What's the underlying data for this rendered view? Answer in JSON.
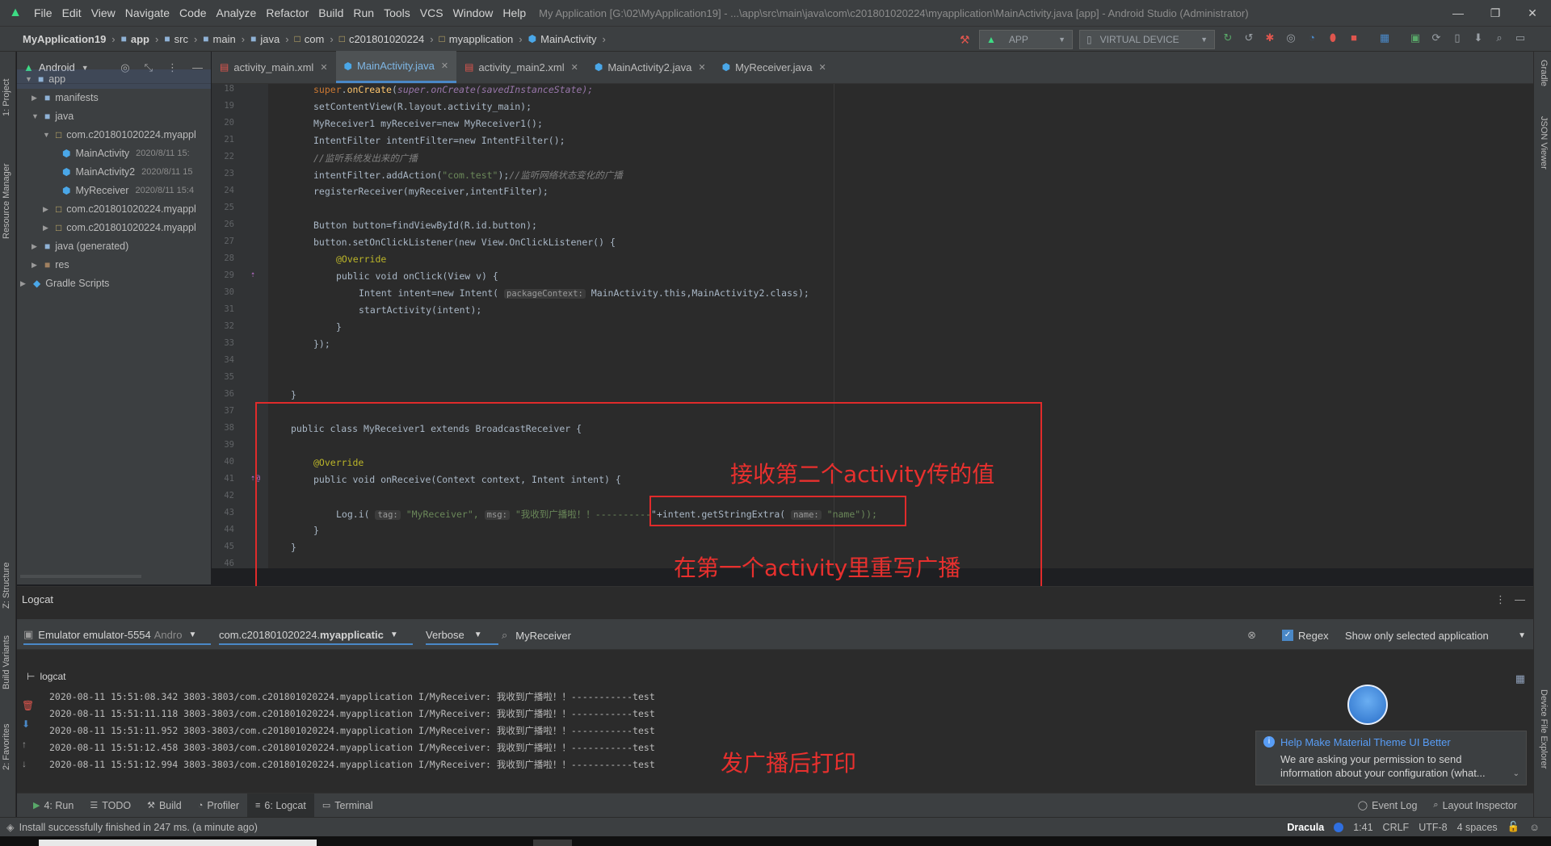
{
  "titlebar": {
    "menu": [
      "File",
      "Edit",
      "View",
      "Navigate",
      "Code",
      "Analyze",
      "Refactor",
      "Build",
      "Run",
      "Tools",
      "VCS",
      "Window",
      "Help"
    ],
    "window_title": "My Application [G:\\02\\MyApplication19] - ...\\app\\src\\main\\java\\com\\c201801020224\\myapplication\\MainActivity.java [app] - Android Studio (Administrator)",
    "minimize": "—",
    "maximize": "❐",
    "close": "✕"
  },
  "breadcrumb": [
    "MyApplication19",
    "app",
    "src",
    "main",
    "java",
    "com",
    "c201801020224",
    "myapplication",
    "MainActivity"
  ],
  "run_config": {
    "module": "APP",
    "device": "VIRTUAL DEVICE"
  },
  "left_strip": {
    "project": "1: Project",
    "resource_manager": "Resource Manager",
    "structure": "Z: Structure",
    "build_variants": "Build Variants",
    "favorites": "2: Favorites"
  },
  "right_strip": {
    "gradle": "Gradle",
    "json_viewer": "JSON Viewer",
    "device_file_explorer": "Device File Explorer"
  },
  "project": {
    "view_mode": "Android",
    "tree": [
      {
        "label": "app",
        "date": ""
      },
      {
        "label": "manifests",
        "date": ""
      },
      {
        "label": "java",
        "date": ""
      },
      {
        "label": "com.c201801020224.myappl",
        "date": ""
      },
      {
        "label": "MainActivity",
        "date": "2020/8/11 15:"
      },
      {
        "label": "MainActivity2",
        "date": "2020/8/11 15"
      },
      {
        "label": "MyReceiver",
        "date": "2020/8/11 15:4"
      },
      {
        "label": "com.c201801020224.myappl",
        "date": ""
      },
      {
        "label": "com.c201801020224.myappl",
        "date": ""
      },
      {
        "label": "java (generated)",
        "date": ""
      },
      {
        "label": "res",
        "date": ""
      },
      {
        "label": "Gradle Scripts",
        "date": ""
      }
    ]
  },
  "tabs": [
    {
      "label": "activity_main.xml",
      "active": false
    },
    {
      "label": "MainActivity.java",
      "active": true
    },
    {
      "label": "activity_main2.xml",
      "active": false
    },
    {
      "label": "MainActivity2.java",
      "active": false
    },
    {
      "label": "MyReceiver.java",
      "active": false
    }
  ],
  "editor": {
    "line_numbers": [
      "18",
      "19",
      "20",
      "21",
      "22",
      "23",
      "24",
      "25",
      "26",
      "27",
      "28",
      "29",
      "30",
      "31",
      "32",
      "33",
      "34",
      "35",
      "36",
      "37",
      "38",
      "39",
      "40",
      "41",
      "42",
      "43",
      "44",
      "45",
      "46"
    ],
    "lines": {
      "l18": "super.onCreate(savedInstanceState);",
      "l19": "setContentView(R.layout.activity_main);",
      "l20": "MyReceiver1 myReceiver=new MyReceiver1();",
      "l21": "IntentFilter intentFilter=new IntentFilter();",
      "l22": "//监听系统发出来的广播",
      "l23a": "intentFilter.addAction(",
      "l23b": "\"com.test\"",
      "l23c": ");",
      "l23d": "//监听网络状态变化的广播",
      "l24": "registerReceiver(myReceiver,intentFilter);",
      "l26": "Button button=findViewById(R.id.button);",
      "l27": "button.setOnClickListener(new View.OnClickListener() {",
      "l28": "@Override",
      "l29": "public void onClick(View v) {",
      "l30a": "Intent intent=new Intent( ",
      "l30hint": "packageContext:",
      "l30b": " MainActivity.this,MainActivity2.class);",
      "l31": "startActivity(intent);",
      "l32": "}",
      "l33": "});",
      "l36": "}",
      "l38": "public class MyReceiver1 extends BroadcastReceiver {",
      "l40": "@Override",
      "l41": "public void onReceive(Context context, Intent intent) {",
      "l43a": "Log.i( ",
      "l43hint1": "tag:",
      "l43b": " \"MyReceiver\", ",
      "l43hint2": "msg:",
      "l43c": " \"我收到广播啦！！----------",
      "l43d": "\"+intent.getStringExtra( ",
      "l43hint3": "name:",
      "l43e": " \"name\"));",
      "l44": "}",
      "l45": "}"
    }
  },
  "annotations": {
    "receive_value": "接收第二个activity传的值",
    "override_broadcast": "在第一个activity里重写广播",
    "print_after_broadcast": "发广播后打印"
  },
  "logcat": {
    "title": "Logcat",
    "device": "Emulator emulator-5554",
    "device_suffix": "Andro",
    "process": "com.c201801020224.",
    "process_bold": "myapplicatic",
    "level": "Verbose",
    "search": "MyReceiver",
    "regex_label": "Regex",
    "filter": "Show only selected application",
    "tab": "logcat",
    "lines": [
      "2020-08-11 15:51:08.342 3803-3803/com.c201801020224.myapplication I/MyReceiver: 我收到广播啦！！-----------test",
      "2020-08-11 15:51:11.118 3803-3803/com.c201801020224.myapplication I/MyReceiver: 我收到广播啦！！-----------test",
      "2020-08-11 15:51:11.952 3803-3803/com.c201801020224.myapplication I/MyReceiver: 我收到广播啦！！-----------test",
      "2020-08-11 15:51:12.458 3803-3803/com.c201801020224.myapplication I/MyReceiver: 我收到广播啦！！-----------test",
      "2020-08-11 15:51:12.994 3803-3803/com.c201801020224.myapplication I/MyReceiver: 我收到广播啦！！-----------test"
    ]
  },
  "notification": {
    "title": "Help Make Material Theme UI Better",
    "body": "We are asking your permission to send information about your configuration (what..."
  },
  "bottom_tools": [
    {
      "label": "4: Run",
      "active": false
    },
    {
      "label": "TODO",
      "active": false
    },
    {
      "label": "Build",
      "active": false
    },
    {
      "label": "Profiler",
      "active": false
    },
    {
      "label": "6: Logcat",
      "active": true
    },
    {
      "label": "Terminal",
      "active": false
    }
  ],
  "bottom_right": {
    "event_log": "Event Log",
    "layout_inspector": "Layout Inspector"
  },
  "status": {
    "message": "Install successfully finished in 247 ms. (a minute ago)",
    "theme": "Dracula",
    "position": "1:41",
    "line_sep": "CRLF",
    "encoding": "UTF-8",
    "indent": "4 spaces"
  },
  "colors": {
    "accent": "#4a88c7",
    "annotation_red": "#e02b2b",
    "android_green": "#3ddc84"
  }
}
